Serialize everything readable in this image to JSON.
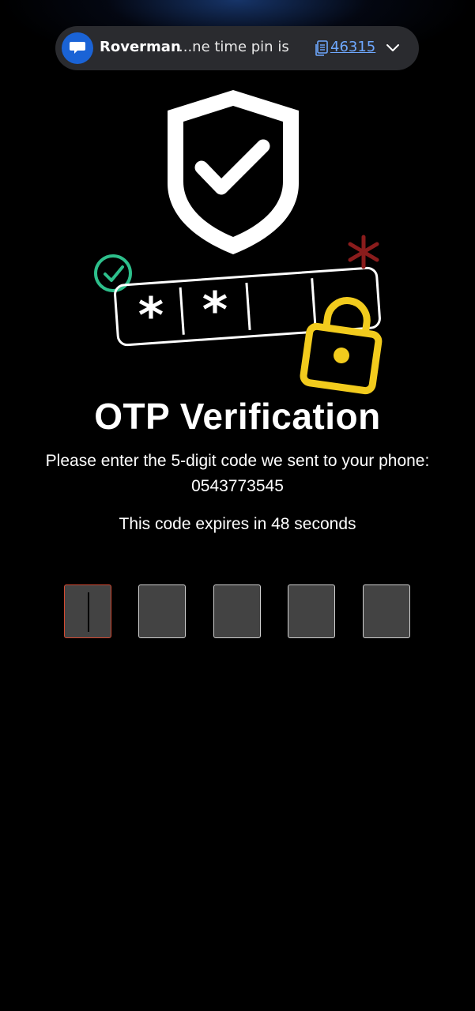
{
  "notification": {
    "app_icon": "chat-bubble-icon",
    "sender": "Roverman",
    "preview": "...ne time pin is",
    "copy_icon": "copy-icon",
    "code": "46315",
    "expand_icon": "chevron-down-icon",
    "app_icon_color": "#1a63d6"
  },
  "hero": {
    "shield_icon": "shield-check-icon",
    "badge_icon": "check-circle-icon",
    "lock_icon": "padlock-icon",
    "asterisk_icon": "asterisk-icon",
    "masked_characters": [
      "*",
      "*"
    ],
    "colors": {
      "check": "#2dbf8b",
      "lock": "#f2cb1d",
      "asterisk": "#8a1c1c"
    }
  },
  "title": "OTP Verification",
  "instructions": "Please enter the 5-digit code we sent to your phone: 0543773545",
  "expiry_text": "This code expires in 48 seconds",
  "otp": {
    "length": 5,
    "values": [
      "",
      "",
      "",
      "",
      ""
    ],
    "active_index": 0,
    "active_border_color": "#d44a32"
  }
}
